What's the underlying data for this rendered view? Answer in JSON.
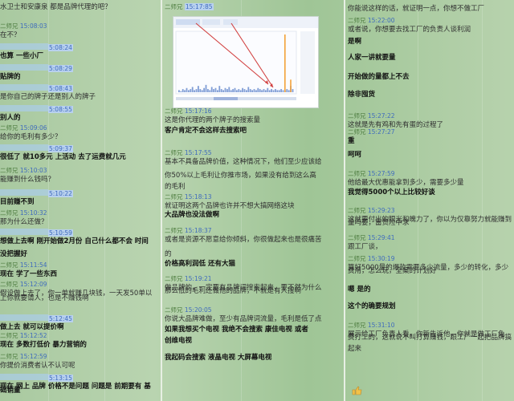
{
  "colors": {
    "name": "#4e7d40",
    "timestamp": "#3f6bbd",
    "highlight": "#aecdf6",
    "background": "#a9c9a0",
    "chart_bar": "#7f9dd6",
    "chart_orange": "#f3a23a",
    "arrow": "#d24040"
  },
  "col1": [
    {
      "name": "",
      "time": "",
      "text": "水卫士和安康泉 都是品牌代理的吧？",
      "bold": false
    },
    {
      "name": "二师兄",
      "time": "15:08:03",
      "text": "在不？",
      "bold": false
    },
    {
      "name": "",
      "time": "5:08:24",
      "text": "也算 一些小厂",
      "bold": true
    },
    {
      "name": "",
      "time": "5:08:29",
      "text": "贴牌的",
      "bold": true
    },
    {
      "name": "",
      "time": "5:08:43",
      "text": "是你自己的牌子还是别人的牌子",
      "bold": false
    },
    {
      "name": "",
      "time": "5:08:55",
      "text": "别人的",
      "bold": true
    },
    {
      "name": "二师兄",
      "time": "15:09:06",
      "text": "给你的毛利有多少？",
      "bold": false
    },
    {
      "name": "",
      "time": "5:09:37",
      "text": "很低了 就10多元 上活动 去了运费就几元",
      "bold": true
    },
    {
      "name": "二师兄",
      "time": "15:10:03",
      "text": "能赚到什么钱吗？",
      "bold": false
    },
    {
      "name": "",
      "time": "5:10:22",
      "text": "目前赚不到",
      "bold": true
    },
    {
      "name": "二师兄",
      "time": "15:10:32",
      "text": "那为什么还做？",
      "bold": false
    },
    {
      "name": "",
      "time": "5:10:59",
      "text": "想做上去啊 刚开始做2月份 自己什么都不会 时间",
      "bold": true
    },
    {
      "name": "",
      "time": "",
      "text": "没把握好",
      "bold": true
    },
    {
      "name": "二师兄",
      "time": "15:11:54",
      "text": "现在 学了一些东西",
      "bold": true
    },
    {
      "name": "二师兄",
      "time": "15:12:09",
      "text": "假设做上去了，你一单就赚几块钱，一天发50单以",
      "bold": false
    },
    {
      "name": "",
      "time": "",
      "text": "上你就要请人，也是不赚钱啊",
      "bold": false
    },
    {
      "name": "",
      "time": "5:12:45",
      "text": "做上去 就可以提价啊",
      "bold": true
    },
    {
      "name": "二师兄",
      "time": "15:12:52",
      "text": "现在 多数打低价 暴力营销的",
      "bold": true
    },
    {
      "name": "二师兄",
      "time": "15:12:59",
      "text": "你提价消费者认不认可呢",
      "bold": false
    },
    {
      "name": "",
      "time": "5:13:15",
      "text": "现在 网上 品牌 价格不是问题 问题是 前期要有 基",
      "bold": true
    },
    {
      "name": "",
      "time": "",
      "text": "础销量",
      "bold": true
    }
  ],
  "col2": [
    {
      "name": "二师兄",
      "time": "15:17:16",
      "text": "这是你代理的两个牌子的搜索量",
      "bold": false
    },
    {
      "name": "",
      "time": "",
      "text": "客户肯定不会这样去搜索吧",
      "bold": true
    },
    {
      "name": "二师兄",
      "time": "15:17:55",
      "text": "基本不具备品牌价值，这种情况下，他们至少应该给",
      "bold": false
    },
    {
      "name": "",
      "time": "",
      "text": "你50%以上毛利让你推市场，如果没有给到这么高",
      "bold": false
    },
    {
      "name": "",
      "time": "",
      "text": "的毛利",
      "bold": false
    },
    {
      "name": "二师兄",
      "time": "15:18:13",
      "text": "就证明这两个品牌也许并不想大搞网络这块",
      "bold": false
    },
    {
      "name": "",
      "time": "",
      "text": "大品牌也没法做啊",
      "bold": true
    },
    {
      "name": "二师兄",
      "time": "15:18:37",
      "text": "或者是资源不愿意给你倾斜，你很做起来也是很痛苦",
      "bold": false
    },
    {
      "name": "",
      "time": "",
      "text": "的",
      "bold": false
    },
    {
      "name": "",
      "time": "",
      "text": "价格高利润低 还有大猫",
      "bold": true
    },
    {
      "name": "二师兄",
      "time": "15:19:21",
      "text": "做品牌的，一定要有品牌词搜索起来，要不然为什么",
      "bold": false
    },
    {
      "name": "",
      "time": "",
      "text": "那么低的毛利还做他的品牌，不就是有人搜啊",
      "bold": false
    },
    {
      "name": "二师兄",
      "time": "15:20:05",
      "text": "你说大品牌难做，至少有品牌词流量，毛利是低了点",
      "bold": false
    },
    {
      "name": "",
      "time": "",
      "text": "如果我想买个电视 我绝不会搜索 康佳电视 或者",
      "bold": true
    },
    {
      "name": "",
      "time": "",
      "text": "创维电视",
      "bold": true
    },
    {
      "name": "",
      "time": "",
      "text": "我起码会搜索 液晶电视 大屏幕电视",
      "bold": true
    }
  ],
  "col3": [
    {
      "name": "",
      "time": "",
      "text": "你能说这样的话，就证明一点，你想不做工厂",
      "bold": false
    },
    {
      "name": "二师兄",
      "time": "15:22:00",
      "text": "或者说，你想要去找工厂的负责人谈利润",
      "bold": false
    },
    {
      "name": "",
      "time": "",
      "text": "是啊",
      "bold": true
    },
    {
      "name": "",
      "time": "",
      "text": "人家一讲就要量",
      "bold": true
    },
    {
      "name": "",
      "time": "",
      "text": "开始做的量都上不去",
      "bold": true
    },
    {
      "name": "",
      "time": "",
      "text": "除非囤货",
      "bold": true
    },
    {
      "name": "二师兄",
      "time": "15:27:22",
      "text": "这就是先有鸡和先有蛋的过程了",
      "bold": false
    },
    {
      "name": "二师兄",
      "time": "15:27:27",
      "text": "重",
      "bold": true
    },
    {
      "name": "",
      "time": "",
      "text": "呵呵",
      "bold": true
    },
    {
      "name": "二师兄",
      "time": "15:27:59",
      "text": "他给最大优惠能拿到多少，需要多少量",
      "bold": false
    },
    {
      "name": "",
      "time": "",
      "text": "我觉得5000个以上比较好谈",
      "bold": true
    },
    {
      "name": "二师兄",
      "time": "15:29:23",
      "text": "这就要付出的眼光和魄力了，你以为仅靠努力就能赚到",
      "bold": false
    },
    {
      "name": "",
      "time": "",
      "text": "量吗要，富贵险中求",
      "bold": false
    },
    {
      "name": "二师兄",
      "time": "15:29:41",
      "text": "跟工厂谈，",
      "bold": false
    },
    {
      "name": "二师兄",
      "time": "15:30:19",
      "text": "算好5000量的爆款需要多少流量，多少的转化，多少",
      "bold": false
    },
    {
      "name": "",
      "time": "",
      "text": "费用，怎么玩，全案的计划好",
      "bold": false
    },
    {
      "name": "",
      "time": "",
      "text": "嗯 是的",
      "bold": true
    },
    {
      "name": "",
      "time": "",
      "text": "这个的确要规划",
      "bold": true
    },
    {
      "name": "二师兄",
      "time": "15:31:10",
      "text": "展示给工厂负责人看，你新告诉他，你就是做工厂免",
      "bold": false
    },
    {
      "name": "",
      "time": "",
      "text": "费打工的，这就说不叫打算赚钱，跟工厂一起把品牌搞",
      "bold": false
    },
    {
      "name": "",
      "time": "",
      "text": "起来",
      "bold": false
    }
  ],
  "screenshot": {
    "header_name": "二师兄",
    "header_time": "15:17:85"
  },
  "chart_data": {
    "type": "bar",
    "title": "",
    "xlabel": "",
    "ylabel": "",
    "series": [
      {
        "values": [
          2,
          1,
          3,
          2,
          4,
          2,
          3,
          5,
          2,
          3,
          6,
          3,
          2,
          4,
          7,
          3,
          2,
          5,
          3,
          4,
          2,
          6,
          3,
          2,
          4,
          3,
          5,
          2,
          3,
          4,
          2,
          3,
          2,
          4,
          3,
          2,
          5,
          3,
          2,
          3,
          2,
          4,
          3,
          2,
          3,
          2,
          4,
          2,
          3,
          2,
          3,
          2,
          2,
          3,
          2,
          2,
          3,
          2,
          6,
          3
        ]
      },
      {
        "values": [
          0,
          0,
          0,
          0,
          0,
          0,
          0,
          0,
          0,
          0,
          0,
          0,
          0,
          0,
          0,
          0,
          0,
          0,
          0,
          0,
          0,
          0,
          0,
          0,
          0,
          0,
          0,
          0,
          0,
          0,
          0,
          0,
          0,
          0,
          0,
          0,
          0,
          0,
          0,
          0,
          0,
          0,
          0,
          0,
          0,
          0,
          0,
          0,
          0,
          0,
          0,
          0,
          0,
          0,
          0,
          55,
          0,
          0,
          12,
          0
        ]
      }
    ]
  }
}
